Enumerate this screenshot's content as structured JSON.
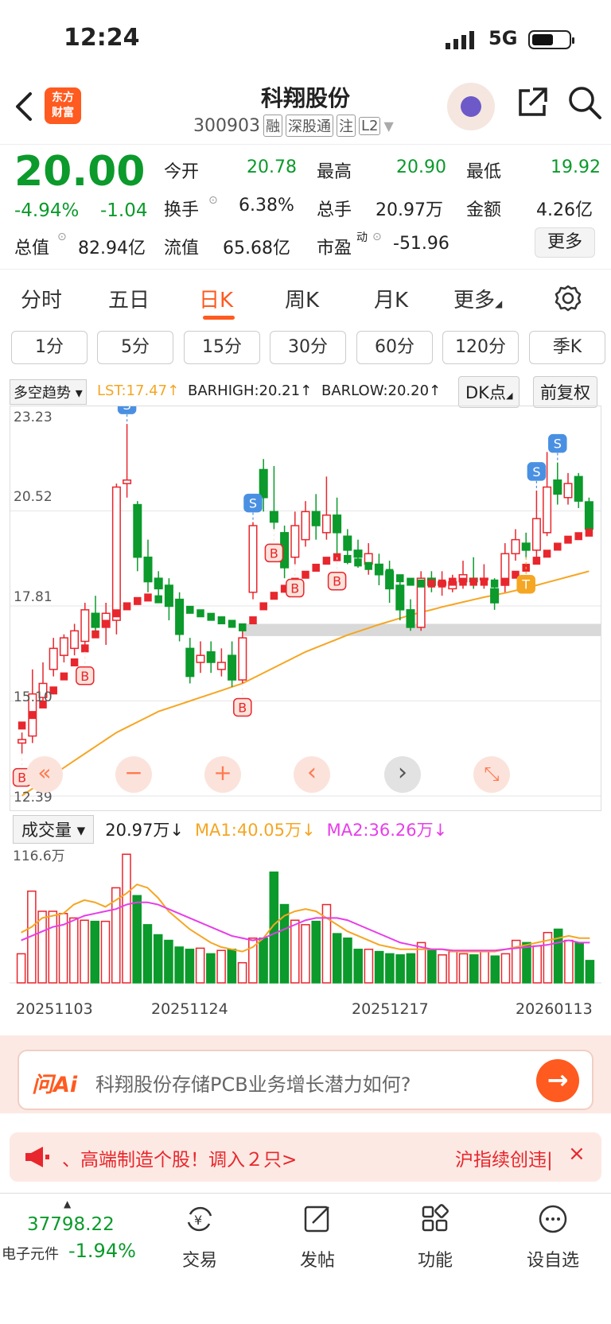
{
  "status_bar": {
    "time": "12:24",
    "network": "5G"
  },
  "header": {
    "logo_text": [
      "东方",
      "财富"
    ],
    "title": "科翔股份",
    "code": "300903",
    "tags": [
      "融",
      "深股通",
      "注",
      "L2"
    ]
  },
  "quote": {
    "price": "20.00",
    "change_pct": "-4.94%",
    "change": "-1.04",
    "labels": {
      "open": "今开",
      "high": "最高",
      "low": "最低",
      "turnover_rate": "换手",
      "volume": "总手",
      "amount": "金额",
      "total_value": "总值",
      "float_value": "流值",
      "pe": "市盈",
      "pe_sup": "动"
    },
    "open": "20.78",
    "high": "20.90",
    "low": "19.92",
    "turnover_rate": "6.38%",
    "volume": "20.97万",
    "amount": "4.26亿",
    "total_value": "82.94亿",
    "float_value": "65.68亿",
    "pe": "-51.96",
    "more_label": "更多"
  },
  "tabs": [
    "分时",
    "五日",
    "日K",
    "周K",
    "月K",
    "更多"
  ],
  "active_tab": "日K",
  "periods": [
    "1分",
    "5分",
    "15分",
    "30分",
    "60分",
    "120分",
    "季K"
  ],
  "indicator": {
    "name": "多空趋势",
    "lst": "LST:17.47↑",
    "barhigh": "BARHIGH:20.21↑",
    "barlow": "BARLOW:20.20↑",
    "dk_btn": "DK点",
    "fq_btn": "前复权"
  },
  "chart_data": {
    "type": "candlestick",
    "y_labels": [
      "23.23",
      "20.52",
      "17.81",
      "15.10",
      "12.39"
    ],
    "ylim": [
      12.39,
      23.23
    ],
    "ma_color": "#f5a623",
    "up_color": "#e8262d",
    "down_color": "#0b9a2b",
    "candles": [
      {
        "o": 13.9,
        "c": 14.0,
        "h": 14.2,
        "l": 13.6
      },
      {
        "o": 14.1,
        "c": 15.3,
        "h": 16.0,
        "l": 13.9
      },
      {
        "o": 15.2,
        "c": 15.6,
        "h": 16.2,
        "l": 15.0
      },
      {
        "o": 16.0,
        "c": 16.6,
        "h": 16.9,
        "l": 15.8
      },
      {
        "o": 16.4,
        "c": 16.9,
        "h": 17.0,
        "l": 16.2
      },
      {
        "o": 16.6,
        "c": 17.1,
        "h": 17.3,
        "l": 16.4
      },
      {
        "o": 16.8,
        "c": 17.7,
        "h": 17.9,
        "l": 16.5
      },
      {
        "o": 17.6,
        "c": 17.2,
        "h": 18.1,
        "l": 17.0
      },
      {
        "o": 17.2,
        "c": 17.6,
        "h": 17.9,
        "l": 16.7
      },
      {
        "o": 17.4,
        "c": 21.2,
        "h": 21.3,
        "l": 17.0
      },
      {
        "o": 21.3,
        "c": 21.4,
        "h": 23.0,
        "l": 20.9
      },
      {
        "o": 20.7,
        "c": 19.2,
        "h": 20.8,
        "l": 18.8
      },
      {
        "o": 19.2,
        "c": 18.5,
        "h": 19.7,
        "l": 18.2
      },
      {
        "o": 18.6,
        "c": 18.3,
        "h": 18.8,
        "l": 17.9
      },
      {
        "o": 18.4,
        "c": 17.8,
        "h": 18.6,
        "l": 17.4
      },
      {
        "o": 18.0,
        "c": 17.0,
        "h": 18.2,
        "l": 16.8
      },
      {
        "o": 16.6,
        "c": 15.8,
        "h": 16.9,
        "l": 15.6
      },
      {
        "o": 16.2,
        "c": 16.4,
        "h": 16.8,
        "l": 15.9
      },
      {
        "o": 16.5,
        "c": 16.2,
        "h": 16.8,
        "l": 15.9
      },
      {
        "o": 16.0,
        "c": 16.2,
        "h": 16.6,
        "l": 15.8
      },
      {
        "o": 16.4,
        "c": 15.7,
        "h": 16.8,
        "l": 15.5
      },
      {
        "o": 15.7,
        "c": 16.9,
        "h": 17.1,
        "l": 15.6
      },
      {
        "o": 18.2,
        "c": 20.1,
        "h": 20.2,
        "l": 18.0
      },
      {
        "o": 21.7,
        "c": 20.9,
        "h": 22.0,
        "l": 20.5
      },
      {
        "o": 20.5,
        "c": 20.2,
        "h": 21.8,
        "l": 20.0
      },
      {
        "o": 19.9,
        "c": 18.9,
        "h": 20.1,
        "l": 18.6
      },
      {
        "o": 19.2,
        "c": 20.1,
        "h": 20.5,
        "l": 19.0
      },
      {
        "o": 19.7,
        "c": 20.5,
        "h": 20.8,
        "l": 19.5
      },
      {
        "o": 20.5,
        "c": 20.1,
        "h": 21.0,
        "l": 19.7
      },
      {
        "o": 19.9,
        "c": 20.4,
        "h": 21.5,
        "l": 19.7
      },
      {
        "o": 20.4,
        "c": 19.9,
        "h": 20.9,
        "l": 19.2
      },
      {
        "o": 19.8,
        "c": 19.4,
        "h": 20.0,
        "l": 19.0
      },
      {
        "o": 19.4,
        "c": 19.2,
        "h": 19.7,
        "l": 18.9
      },
      {
        "o": 19.0,
        "c": 19.3,
        "h": 19.6,
        "l": 18.7
      },
      {
        "o": 19.0,
        "c": 18.7,
        "h": 19.3,
        "l": 18.4
      },
      {
        "o": 18.8,
        "c": 18.3,
        "h": 19.1,
        "l": 17.9
      },
      {
        "o": 18.4,
        "c": 17.7,
        "h": 18.7,
        "l": 17.4
      },
      {
        "o": 17.7,
        "c": 17.2,
        "h": 18.0,
        "l": 17.1
      },
      {
        "o": 17.2,
        "c": 18.6,
        "h": 18.8,
        "l": 17.1
      },
      {
        "o": 18.6,
        "c": 18.4,
        "h": 18.8,
        "l": 18.2
      },
      {
        "o": 18.4,
        "c": 18.5,
        "h": 18.8,
        "l": 18.1
      },
      {
        "o": 18.3,
        "c": 18.5,
        "h": 18.7,
        "l": 18.2
      },
      {
        "o": 18.5,
        "c": 18.7,
        "h": 19.1,
        "l": 18.3
      },
      {
        "o": 18.6,
        "c": 18.5,
        "h": 19.2,
        "l": 18.3
      },
      {
        "o": 18.6,
        "c": 18.6,
        "h": 19.0,
        "l": 18.3
      },
      {
        "o": 18.3,
        "c": 17.9,
        "h": 18.6,
        "l": 17.7
      },
      {
        "o": 18.4,
        "c": 19.3,
        "h": 19.6,
        "l": 18.2
      },
      {
        "o": 19.3,
        "c": 19.7,
        "h": 20.0,
        "l": 19.1
      },
      {
        "o": 19.6,
        "c": 19.4,
        "h": 19.9,
        "l": 19.2
      },
      {
        "o": 19.4,
        "c": 20.3,
        "h": 21.1,
        "l": 19.2
      },
      {
        "o": 19.9,
        "c": 21.2,
        "h": 22.2,
        "l": 19.8
      },
      {
        "o": 21.4,
        "c": 21.0,
        "h": 21.9,
        "l": 20.7
      },
      {
        "o": 20.9,
        "c": 21.3,
        "h": 21.6,
        "l": 20.7
      },
      {
        "o": 21.5,
        "c": 20.8,
        "h": 21.6,
        "l": 20.6
      },
      {
        "o": 20.78,
        "c": 20.0,
        "h": 20.9,
        "l": 19.92
      }
    ],
    "ma_line": [
      12.4,
      12.6,
      12.8,
      13.0,
      13.2,
      13.4,
      13.6,
      13.8,
      14.0,
      14.2,
      14.35,
      14.5,
      14.65,
      14.8,
      14.9,
      15.0,
      15.1,
      15.2,
      15.3,
      15.4,
      15.5,
      15.6,
      15.75,
      15.9,
      16.05,
      16.2,
      16.35,
      16.5,
      16.62,
      16.74,
      16.86,
      16.98,
      17.08,
      17.18,
      17.28,
      17.37,
      17.46,
      17.55,
      17.63,
      17.7,
      17.78,
      17.85,
      17.92,
      17.99,
      18.06,
      18.12,
      18.18,
      18.25,
      18.32,
      18.4,
      18.48,
      18.56,
      18.64,
      18.72,
      18.8
    ],
    "trend_line": [
      14.4,
      14.7,
      15.0,
      15.4,
      15.8,
      16.2,
      16.6,
      17.0,
      17.3,
      17.6,
      17.8,
      17.95,
      18.05,
      18.0,
      17.9,
      17.8,
      17.7,
      17.6,
      17.5,
      17.4,
      17.3,
      17.2,
      17.4,
      17.8,
      18.1,
      18.3,
      18.5,
      18.7,
      18.9,
      19.1,
      19.2,
      19.15,
      19.05,
      18.95,
      18.85,
      18.75,
      18.6,
      18.5,
      18.45,
      18.45,
      18.45,
      18.5,
      18.5,
      18.5,
      18.5,
      18.45,
      18.5,
      18.7,
      18.9,
      19.1,
      19.3,
      19.5,
      19.7,
      19.8,
      19.9
    ],
    "signals": [
      {
        "i": 10,
        "label": "S"
      },
      {
        "i": 49,
        "label": "S"
      },
      {
        "i": 51,
        "label": "S"
      },
      {
        "i": 22,
        "label": "S"
      },
      {
        "i": 6,
        "label": "B"
      },
      {
        "i": 0,
        "label": "B"
      },
      {
        "i": 21,
        "label": "B"
      },
      {
        "i": 24,
        "label": "B"
      },
      {
        "i": 26,
        "label": "B"
      },
      {
        "i": 30,
        "label": "B"
      },
      {
        "i": 48,
        "label": "T"
      }
    ],
    "x_labels": [
      "20251103",
      "20251124",
      "20251217",
      "20260113"
    ]
  },
  "chart_controls": [
    "«",
    "−",
    "+",
    "‹",
    "›",
    "⤡"
  ],
  "volume": {
    "selector": "成交量",
    "value": "20.97万↓",
    "ma1": "MA1:40.05万↓",
    "ma2": "MA2:36.26万↓",
    "max_label": "116.6万",
    "ma1_color": "#f5a623",
    "ma2_color": "#e63ee8",
    "bars": [
      26,
      82,
      64,
      64,
      62,
      58,
      56,
      55,
      55,
      85,
      115,
      78,
      52,
      43,
      38,
      32,
      30,
      31,
      26,
      29,
      30,
      18,
      40,
      40,
      99,
      70,
      56,
      52,
      55,
      70,
      44,
      40,
      30,
      30,
      28,
      26,
      25,
      26,
      36,
      30,
      25,
      28,
      26,
      25,
      28,
      24,
      26,
      38,
      36,
      33,
      45,
      48,
      38,
      36,
      20
    ],
    "ma1_line": [
      45,
      50,
      58,
      60,
      62,
      70,
      74,
      72,
      68,
      74,
      80,
      88,
      85,
      76,
      64,
      56,
      48,
      42,
      36,
      32,
      30,
      28,
      32,
      40,
      52,
      60,
      64,
      66,
      64,
      58,
      52,
      46,
      42,
      38,
      34,
      32,
      30,
      30,
      30,
      30,
      30,
      28,
      28,
      28,
      28,
      28,
      30,
      32,
      34,
      36,
      38,
      40,
      42,
      40,
      40
    ],
    "ma2_line": [
      38,
      42,
      46,
      50,
      52,
      56,
      60,
      62,
      64,
      66,
      70,
      72,
      72,
      70,
      66,
      62,
      58,
      54,
      50,
      46,
      42,
      40,
      38,
      40,
      44,
      48,
      52,
      56,
      58,
      58,
      58,
      56,
      52,
      48,
      44,
      40,
      36,
      34,
      32,
      30,
      30,
      29,
      29,
      29,
      29,
      29,
      30,
      31,
      32,
      33,
      34,
      36,
      38,
      36,
      36
    ]
  },
  "ai": {
    "logo": "问Ai",
    "question": "科翔股份存储PCB业务增长潜力如何?"
  },
  "notice": {
    "text": "、高端制造个股！调入２只>",
    "right": "沪指续创违|",
    "close": "×"
  },
  "bottom_nav": {
    "index_value": "37798.22",
    "index_name": "电子元件",
    "index_change": "-1.94%",
    "items": [
      "交易",
      "发帖",
      "功能",
      "设自选"
    ]
  }
}
